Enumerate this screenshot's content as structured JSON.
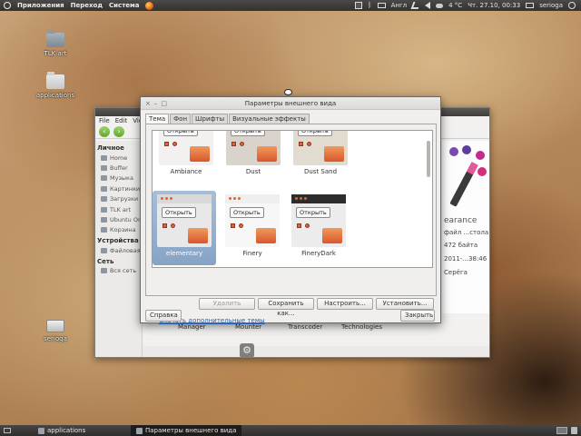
{
  "top_panel": {
    "menus": [
      "Приложения",
      "Переход",
      "Система"
    ],
    "keyboard_layout": "Англ",
    "weather": "4 °C",
    "clock": "Чт. 27.10, 00:33",
    "user": "serioga"
  },
  "desktop": {
    "icons": [
      {
        "label": "TLK art",
        "icon": "folder-icon"
      },
      {
        "label": "applications",
        "icon": "folder-icon"
      },
      {
        "label": "serioga",
        "icon": "drive-icon"
      }
    ]
  },
  "nautilus": {
    "menu": [
      "File",
      "Edit",
      "View"
    ],
    "sidebar": {
      "personal_header": "Личное",
      "personal_items": [
        "Home",
        "Buffer",
        "Музыка",
        "Картинки",
        "Загрузки",
        "TLK art",
        "Ubuntu One",
        "Корзина"
      ],
      "devices_header": "Устройства",
      "devices_items": [
        "Файловая..."
      ],
      "network_header": "Сеть",
      "network_items": [
        "Вся сеть"
      ]
    },
    "files": [
      "Manager",
      "Mounter",
      "Transcoder",
      "Technologies"
    ],
    "info": {
      "title": "earance",
      "type": "файл ...стола",
      "size": "472 байта",
      "date": "2011-...38:46",
      "owner": "Серёга"
    }
  },
  "dialog": {
    "title": "Параметры внешнего вида",
    "tabs": [
      "Тема",
      "Фон",
      "Шрифты",
      "Визуальные эффекты"
    ],
    "active_tab": "Тема",
    "preview_button_label": "Открыть",
    "themes": [
      {
        "name": "Ambiance",
        "bar": "#3c3b37",
        "body": "#f2f1f0"
      },
      {
        "name": "Dust",
        "bar": "#4a3b31",
        "body": "#d9d3cc"
      },
      {
        "name": "Dust Sand",
        "bar": "#b8ab97",
        "body": "#e2dbcf"
      },
      {
        "name": "elementary",
        "bar": "#d9d9d9",
        "body": "#e8e8e8",
        "selected": true
      },
      {
        "name": "Finery",
        "bar": "#efefef",
        "body": "#f7f7f7"
      },
      {
        "name": "FineryDark",
        "bar": "#2c2c2c",
        "body": "#ececec"
      }
    ],
    "buttons": {
      "delete": "Удалить",
      "save_as": "Сохранить как...",
      "customize": "Настроить...",
      "install": "Установить..."
    },
    "more_themes_link": "Скачать дополнительные темы",
    "help": "Справка",
    "close": "Закрыть"
  },
  "bottom_panel": {
    "tasks": [
      "applications",
      "Параметры внешнего вида"
    ]
  }
}
